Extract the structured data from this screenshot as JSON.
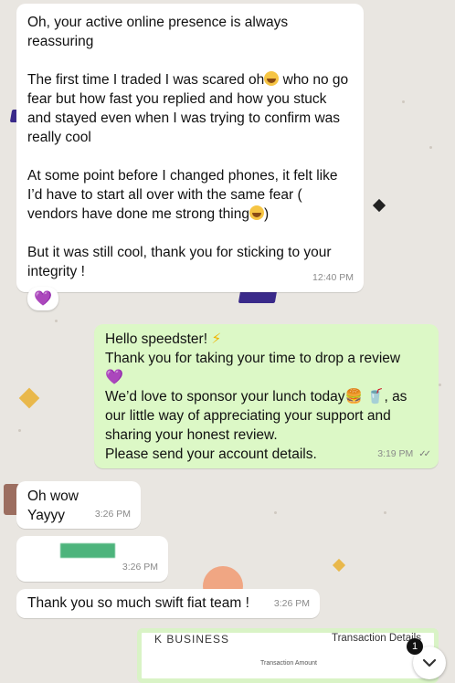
{
  "colors": {
    "wallpaper": "#e9e6e1",
    "incoming_bubble": "#ffffff",
    "outgoing_bubble": "#dcf8c6",
    "timestamp": "#8a8a8a",
    "read_ticks": "#7a7a7a",
    "reaction_heart": "#9b3cdc"
  },
  "messages": [
    {
      "direction": "in",
      "paragraphs": [
        "Oh, your active online presence is always reassuring",
        "The first time I traded I was scared oh",
        " who no go fear but how fast you replied and how you stuck and stayed even when I was trying to confirm was really cool",
        "At some point before I changed phones, it felt like I’d have to start all over with the same fear ( vendors have done me strong thing",
        ")",
        "But it was still cool, thank you for sticking to your integrity !"
      ],
      "time": "12:40 PM",
      "reaction": "💜"
    },
    {
      "direction": "out",
      "lines": [
        "Hello speedster! ",
        "⚡",
        "Thank you for taking your time to drop a review",
        "💜",
        "We’d love to sponsor your lunch today",
        "🍔",
        "🥤",
        ", as our little way of appreciating your support and sharing your honest review.",
        "Please send your account details."
      ],
      "time": "3:19 PM",
      "ticks": "✓✓"
    },
    {
      "direction": "in",
      "lines": [
        "Oh wow",
        "Yayyy"
      ],
      "time": "3:26 PM"
    },
    {
      "direction": "in",
      "time": "3:26 PM"
    },
    {
      "direction": "in",
      "lines": [
        "Thank you so much swift fiat team !"
      ],
      "time": "3:26 PM"
    }
  ],
  "attachment": {
    "brand": "K BUSINESS",
    "header": "Transaction Details",
    "amount_label": "Transaction Amount"
  },
  "unread_badge": "1",
  "icons": {
    "scroll_down": "chevron-down-icon",
    "lightning": "lightning-icon",
    "heart": "purple-heart-icon"
  }
}
